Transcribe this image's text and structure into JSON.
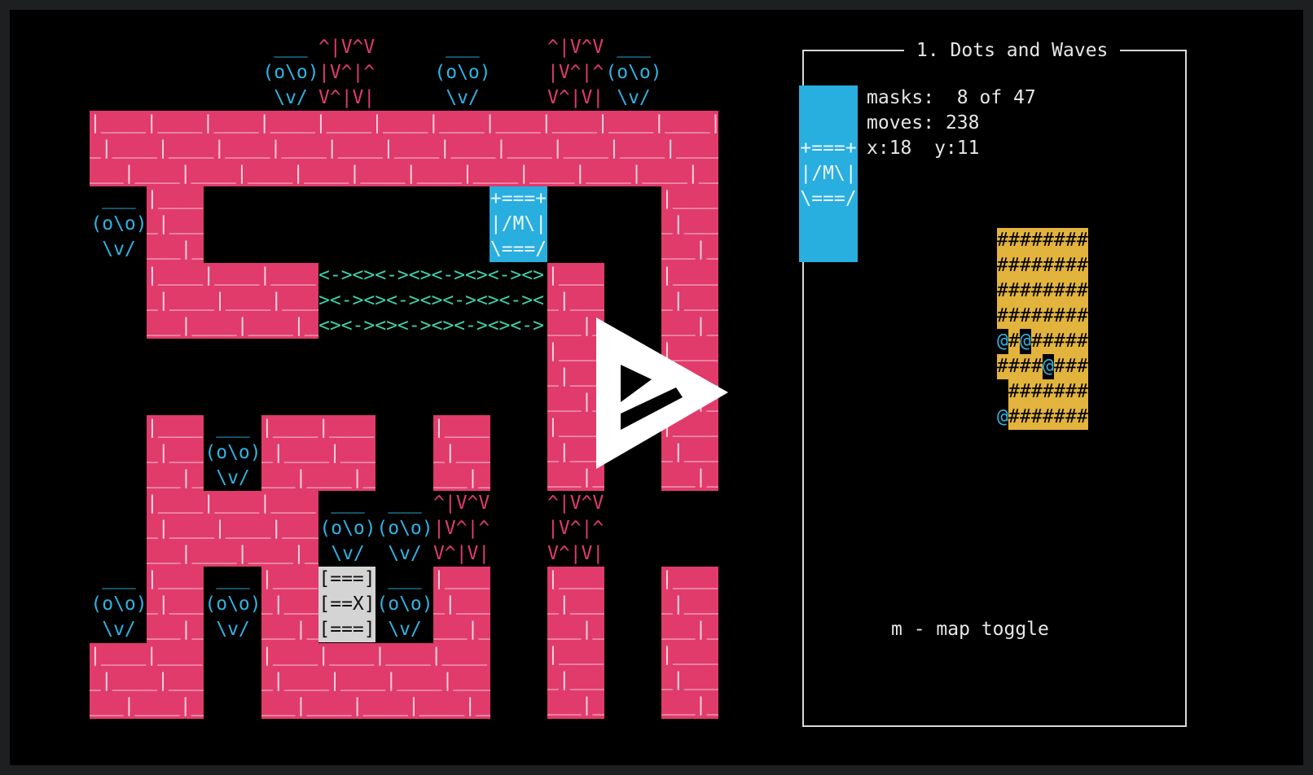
{
  "level": {
    "title": "1. Dots and Waves"
  },
  "stats": {
    "masks_label": "masks:",
    "masks_value": " 8 of 47",
    "moves_label": "moves:",
    "moves_value": "238",
    "pos_label": "x:18  y:11"
  },
  "hint": "m - map toggle",
  "glyphs": {
    "monster": [
      "___",
      "(o\\o)",
      "\\v/"
    ],
    "spikes": [
      "^|V^V",
      "|V^|^",
      "V^|V|"
    ],
    "mask": [
      "+===+",
      "|/M\\|",
      "\\===/"
    ],
    "door": [
      "[===]",
      "[==X]",
      "[===]"
    ],
    "waves": [
      "<-><><-><><-><><-><>",
      "><-><><-><><-><><-><",
      "<><-><><-><><-><><->"
    ],
    "brick_rows": [
      "|____|____|____|____|____|____|____|____|____|____|____|____",
      "_|____|____|____|____|____|____|____|____|____|____|____|___",
      "___|____|____|____|____|____|____|____|____|____|____|____|_"
    ],
    "minimap": [
      "########",
      "########",
      "########",
      "########",
      "@#@#####",
      "####@###",
      " #######",
      "@#######"
    ],
    "minimap_char": "#"
  },
  "colors": {
    "brick": "#e03b6b",
    "monster": "#2fb3e3",
    "wave": "#3ed1a8",
    "mask_bg": "#29aee0",
    "minimap": "#e2b33d",
    "door": "#d4d4d4"
  },
  "icons": {
    "overlay": "play-icon"
  }
}
